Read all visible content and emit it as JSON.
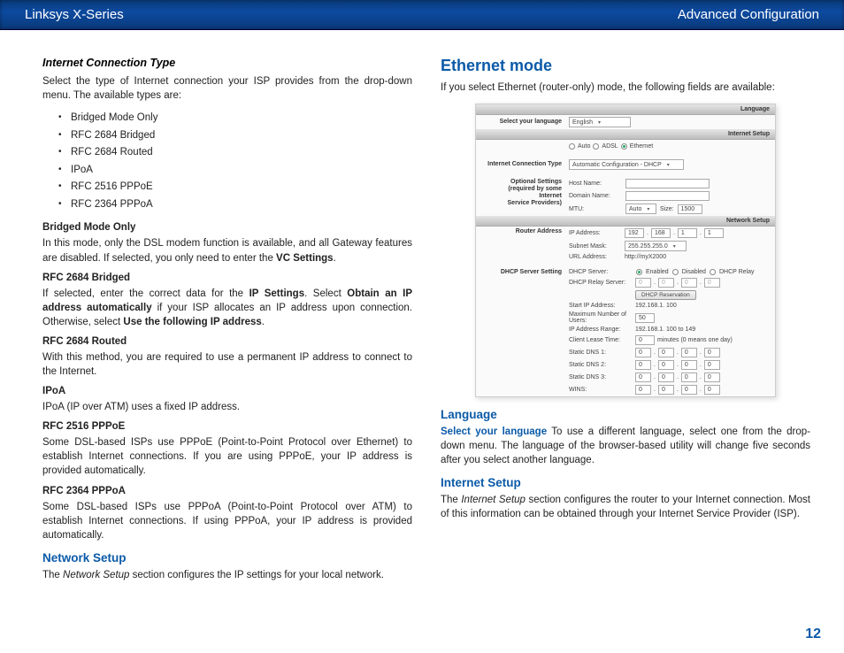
{
  "header": {
    "left": "Linksys X-Series",
    "right": "Advanced Configuration"
  },
  "page_number": "12",
  "left": {
    "section_title": "Internet Connection Type",
    "intro": "Select the type of Internet connection your ISP provides from the drop-down menu. The available types are:",
    "types": [
      "Bridged Mode Only",
      "RFC 2684 Bridged",
      "RFC 2684 Routed",
      "IPoA",
      "RFC 2516 PPPoE",
      "RFC 2364 PPPoA"
    ],
    "bridged": {
      "head": "Bridged Mode Only",
      "body_pre": "In this mode, only the DSL modem function is available, and all Gateway features are disabled. If selected, you only need to enter the ",
      "body_bold": "VC Settings",
      "body_post": "."
    },
    "r2684b": {
      "head": "RFC 2684 Bridged",
      "body_pre": "If selected, enter the correct data for the ",
      "b1": "IP Settings",
      "mid1": ". Select ",
      "b2": "Obtain an IP address automatically",
      "mid2": " if your ISP allocates an IP address upon connection. Otherwise, select ",
      "b3": "Use the following IP address",
      "post": "."
    },
    "r2684r": {
      "head": "RFC 2684 Routed",
      "body": "With this method, you are required to use a permanent IP address to connect to the Internet."
    },
    "ipoa": {
      "head": "IPoA",
      "body": "IPoA (IP over ATM) uses a fixed IP address."
    },
    "pppoe": {
      "head": "RFC 2516 PPPoE",
      "body": "Some DSL-based ISPs use PPPoE (Point-to-Point Protocol over Ethernet) to establish Internet connections. If you are using PPPoE, your IP address is provided automatically."
    },
    "pppoa": {
      "head": "RFC 2364 PPPoA",
      "body": "Some DSL-based ISPs use PPPoA (Point-to-Point Protocol over ATM) to establish Internet connections. If using PPPoA, your IP address is provided automatically."
    },
    "netsetup": {
      "head": "Network Setup",
      "body_pre": "The ",
      "italic": "Network Setup",
      "body_post": " section configures the IP settings for your local network."
    }
  },
  "right": {
    "h2": "Ethernet mode",
    "intro": "If you select Ethernet (router-only) mode, the following fields are available:",
    "lang": {
      "head": "Language",
      "runin": "Select your language",
      "body": "  To use a different language, select one from the drop-down menu. The language of the browser-based utility will change five seconds after you select another language."
    },
    "isetup": {
      "head": "Internet Setup",
      "body_pre": "The ",
      "italic": "Internet Setup",
      "body_post": " section configures the router to your Internet connection. Most of this information can be obtained through your Internet Service Provider (ISP)."
    }
  },
  "ss": {
    "bar_language": "Language",
    "sel_lang_label": "Select your language",
    "sel_lang_value": "English",
    "bar_isetup": "Internet Setup",
    "mode_auto": "Auto",
    "mode_adsl": "ADSL",
    "mode_eth": "Ethernet",
    "ict_label": "Internet Connection Type",
    "ict_value": "Automatic Configuration - DHCP",
    "opt_label": "Optional Settings\n(required by some Internet\nService Providers)",
    "hostname": "Host Name:",
    "domainname": "Domain Name:",
    "mtu": "MTU:",
    "mtu_mode": "Auto",
    "mtu_size_lbl": "Size:",
    "mtu_size": "1500",
    "bar_net": "Network Setup",
    "router_addr": "Router Address",
    "ip_lbl": "IP Address:",
    "ip": [
      "192",
      "168",
      "1",
      "1"
    ],
    "mask_lbl": "Subnet Mask:",
    "mask": "255.255.255.0",
    "url_lbl": "URL Address:",
    "url": "http://myX2000",
    "dhcp_setting": "DHCP Server Setting",
    "dhcp_srv": "DHCP Server:",
    "dhcp_on": "Enabled",
    "dhcp_off": "Disabled",
    "dhcp_relay": "DHCP Relay",
    "dhcp_relay_srv": "DHCP Relay Server:",
    "relay_ip": [
      "0",
      "0",
      "0",
      "0"
    ],
    "dhcp_res_btn": "DHCP Reservation",
    "start_ip": "Start IP Address:",
    "start_ip_val": "192.168.1. 100",
    "max_users": "Maximum Number of\nUsers:",
    "max_users_val": "50",
    "ip_range": "IP Address Range:",
    "ip_range_val": "192.168.1. 100 to 149",
    "lease": "Client Lease Time:",
    "lease_val": "0",
    "lease_unit": "minutes (0 means one day)",
    "dns1": "Static DNS 1:",
    "dns2": "Static DNS 2:",
    "dns3": "Static DNS 3:",
    "wins": "WINS:",
    "zero": [
      "0",
      "0",
      "0",
      "0"
    ]
  }
}
